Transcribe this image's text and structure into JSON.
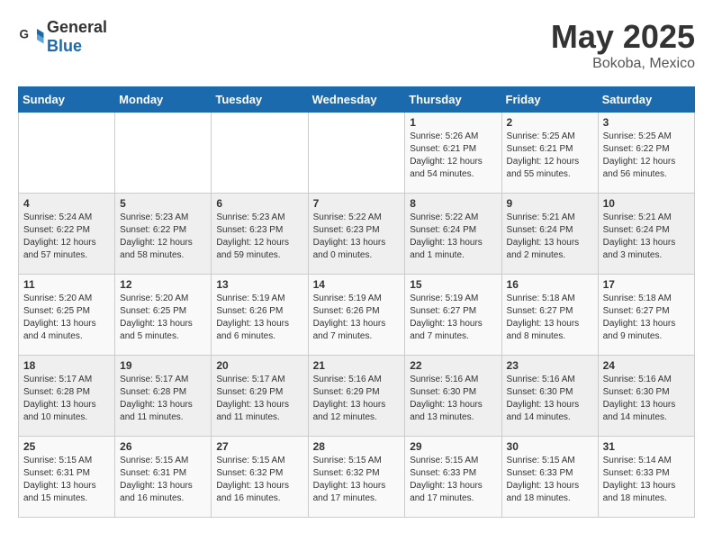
{
  "header": {
    "logo_general": "General",
    "logo_blue": "Blue",
    "month_year": "May 2025",
    "location": "Bokoba, Mexico"
  },
  "days_of_week": [
    "Sunday",
    "Monday",
    "Tuesday",
    "Wednesday",
    "Thursday",
    "Friday",
    "Saturday"
  ],
  "weeks": [
    [
      {
        "day": "",
        "info": ""
      },
      {
        "day": "",
        "info": ""
      },
      {
        "day": "",
        "info": ""
      },
      {
        "day": "",
        "info": ""
      },
      {
        "day": "1",
        "info": "Sunrise: 5:26 AM\nSunset: 6:21 PM\nDaylight: 12 hours\nand 54 minutes."
      },
      {
        "day": "2",
        "info": "Sunrise: 5:25 AM\nSunset: 6:21 PM\nDaylight: 12 hours\nand 55 minutes."
      },
      {
        "day": "3",
        "info": "Sunrise: 5:25 AM\nSunset: 6:22 PM\nDaylight: 12 hours\nand 56 minutes."
      }
    ],
    [
      {
        "day": "4",
        "info": "Sunrise: 5:24 AM\nSunset: 6:22 PM\nDaylight: 12 hours\nand 57 minutes."
      },
      {
        "day": "5",
        "info": "Sunrise: 5:23 AM\nSunset: 6:22 PM\nDaylight: 12 hours\nand 58 minutes."
      },
      {
        "day": "6",
        "info": "Sunrise: 5:23 AM\nSunset: 6:23 PM\nDaylight: 12 hours\nand 59 minutes."
      },
      {
        "day": "7",
        "info": "Sunrise: 5:22 AM\nSunset: 6:23 PM\nDaylight: 13 hours\nand 0 minutes."
      },
      {
        "day": "8",
        "info": "Sunrise: 5:22 AM\nSunset: 6:24 PM\nDaylight: 13 hours\nand 1 minute."
      },
      {
        "day": "9",
        "info": "Sunrise: 5:21 AM\nSunset: 6:24 PM\nDaylight: 13 hours\nand 2 minutes."
      },
      {
        "day": "10",
        "info": "Sunrise: 5:21 AM\nSunset: 6:24 PM\nDaylight: 13 hours\nand 3 minutes."
      }
    ],
    [
      {
        "day": "11",
        "info": "Sunrise: 5:20 AM\nSunset: 6:25 PM\nDaylight: 13 hours\nand 4 minutes."
      },
      {
        "day": "12",
        "info": "Sunrise: 5:20 AM\nSunset: 6:25 PM\nDaylight: 13 hours\nand 5 minutes."
      },
      {
        "day": "13",
        "info": "Sunrise: 5:19 AM\nSunset: 6:26 PM\nDaylight: 13 hours\nand 6 minutes."
      },
      {
        "day": "14",
        "info": "Sunrise: 5:19 AM\nSunset: 6:26 PM\nDaylight: 13 hours\nand 7 minutes."
      },
      {
        "day": "15",
        "info": "Sunrise: 5:19 AM\nSunset: 6:27 PM\nDaylight: 13 hours\nand 7 minutes."
      },
      {
        "day": "16",
        "info": "Sunrise: 5:18 AM\nSunset: 6:27 PM\nDaylight: 13 hours\nand 8 minutes."
      },
      {
        "day": "17",
        "info": "Sunrise: 5:18 AM\nSunset: 6:27 PM\nDaylight: 13 hours\nand 9 minutes."
      }
    ],
    [
      {
        "day": "18",
        "info": "Sunrise: 5:17 AM\nSunset: 6:28 PM\nDaylight: 13 hours\nand 10 minutes."
      },
      {
        "day": "19",
        "info": "Sunrise: 5:17 AM\nSunset: 6:28 PM\nDaylight: 13 hours\nand 11 minutes."
      },
      {
        "day": "20",
        "info": "Sunrise: 5:17 AM\nSunset: 6:29 PM\nDaylight: 13 hours\nand 11 minutes."
      },
      {
        "day": "21",
        "info": "Sunrise: 5:16 AM\nSunset: 6:29 PM\nDaylight: 13 hours\nand 12 minutes."
      },
      {
        "day": "22",
        "info": "Sunrise: 5:16 AM\nSunset: 6:30 PM\nDaylight: 13 hours\nand 13 minutes."
      },
      {
        "day": "23",
        "info": "Sunrise: 5:16 AM\nSunset: 6:30 PM\nDaylight: 13 hours\nand 14 minutes."
      },
      {
        "day": "24",
        "info": "Sunrise: 5:16 AM\nSunset: 6:30 PM\nDaylight: 13 hours\nand 14 minutes."
      }
    ],
    [
      {
        "day": "25",
        "info": "Sunrise: 5:15 AM\nSunset: 6:31 PM\nDaylight: 13 hours\nand 15 minutes."
      },
      {
        "day": "26",
        "info": "Sunrise: 5:15 AM\nSunset: 6:31 PM\nDaylight: 13 hours\nand 16 minutes."
      },
      {
        "day": "27",
        "info": "Sunrise: 5:15 AM\nSunset: 6:32 PM\nDaylight: 13 hours\nand 16 minutes."
      },
      {
        "day": "28",
        "info": "Sunrise: 5:15 AM\nSunset: 6:32 PM\nDaylight: 13 hours\nand 17 minutes."
      },
      {
        "day": "29",
        "info": "Sunrise: 5:15 AM\nSunset: 6:33 PM\nDaylight: 13 hours\nand 17 minutes."
      },
      {
        "day": "30",
        "info": "Sunrise: 5:15 AM\nSunset: 6:33 PM\nDaylight: 13 hours\nand 18 minutes."
      },
      {
        "day": "31",
        "info": "Sunrise: 5:14 AM\nSunset: 6:33 PM\nDaylight: 13 hours\nand 18 minutes."
      }
    ]
  ]
}
